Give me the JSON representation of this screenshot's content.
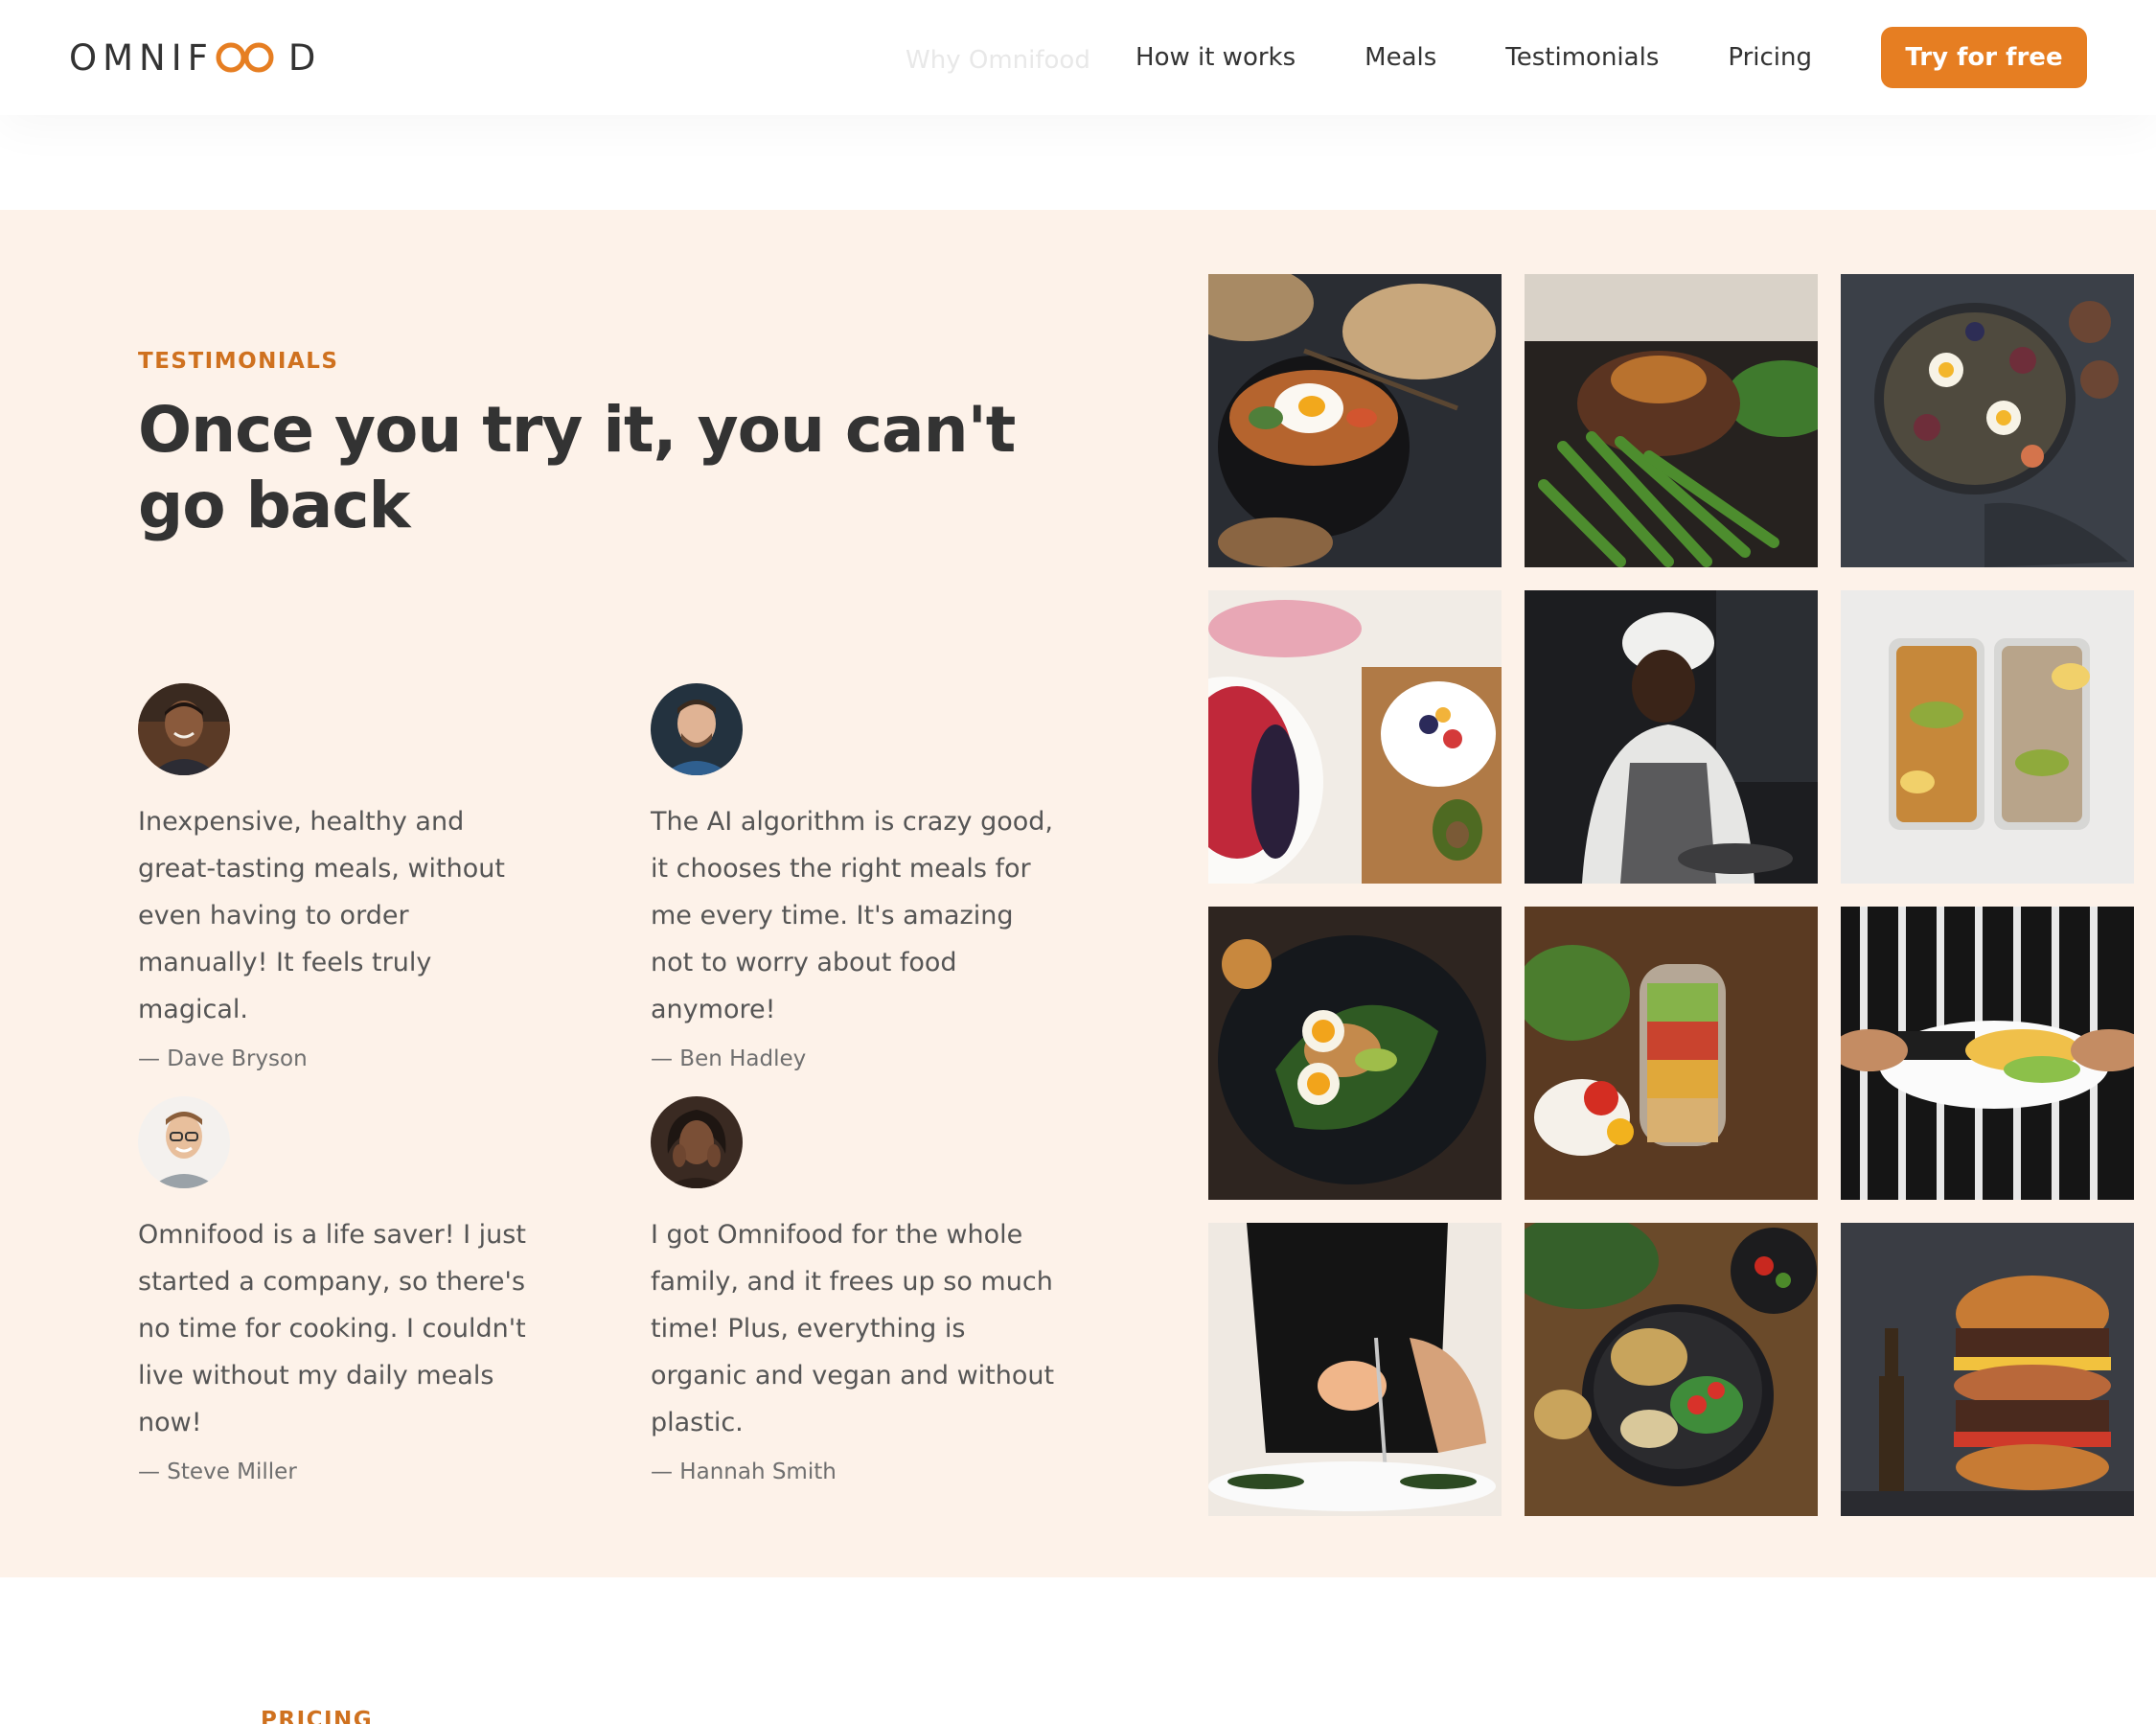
{
  "brand": {
    "name_before": "OMNIF",
    "name_after": "D",
    "accent": "#e67e22"
  },
  "nav": {
    "ghost_link": "Why Omnifood",
    "links": [
      "How it works",
      "Meals",
      "Testimonials",
      "Pricing"
    ],
    "cta": "Try for free"
  },
  "section": {
    "subheading": "Testimonials",
    "heading": "Once you try it, you can't go back",
    "background": "#fdf2e9"
  },
  "testimonials": [
    {
      "quote": "Inexpensive, healthy and great-tasting meals, without even having to order manually! It feels truly magical.",
      "name": "— Dave Bryson"
    },
    {
      "quote": "The AI algorithm is crazy good, it chooses the right meals for me every time. It's amazing not to worry about food anymore!",
      "name": "— Ben Hadley"
    },
    {
      "quote": "Omnifood is a life saver! I just started a company, so there's no time for cooking. I couldn't live without my daily meals now!",
      "name": "— Steve Miller"
    },
    {
      "quote": "I got Omnifood for the whole family, and it frees up so much time! Plus, everything is organic and vegan and without plastic.",
      "name": "— Hannah Smith"
    }
  ],
  "gallery": [
    {
      "icon": "bibimbap-bowl-photo"
    },
    {
      "icon": "steak-green-beans-photo"
    },
    {
      "icon": "eggs-figs-platter-photo"
    },
    {
      "icon": "fruit-board-photo"
    },
    {
      "icon": "chef-cooking-photo"
    },
    {
      "icon": "meal-prep-containers-photo"
    },
    {
      "icon": "egg-avocado-toast-photo"
    },
    {
      "icon": "salad-jar-photo"
    },
    {
      "icon": "plated-dish-chef-photo"
    },
    {
      "icon": "chef-plating-photo"
    },
    {
      "icon": "grain-bowl-photo"
    },
    {
      "icon": "burger-photo"
    }
  ],
  "next_section": {
    "subheading": "PRICING"
  }
}
